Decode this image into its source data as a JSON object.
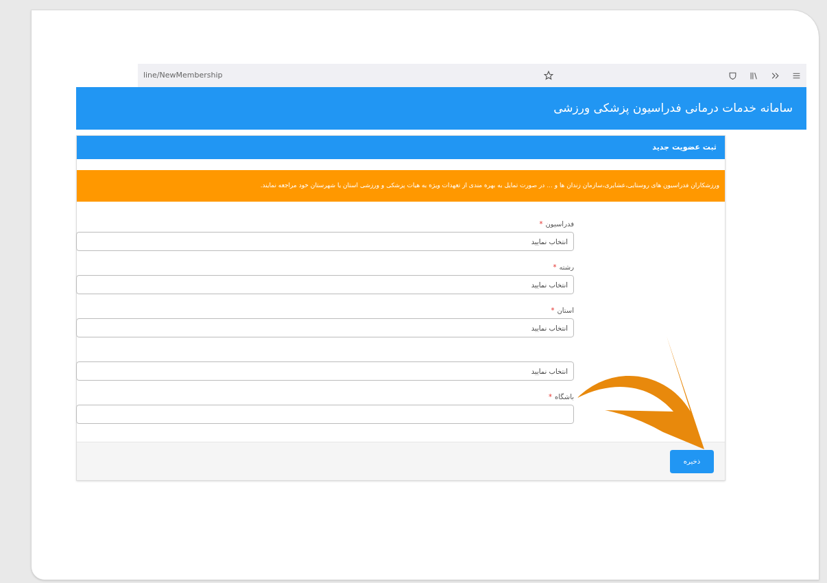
{
  "browser": {
    "url": "line/NewMembership"
  },
  "site_header": {
    "title": "سامانه خدمات درمانی فدراسیون پزشکی ورزشی"
  },
  "card": {
    "title": "ثبت عضویت جدید",
    "notice": "ورزشکاران فدراسیون های روستایی،عشایری،سازمان زندان ها و ... در صورت تمایل به بهره مندی از تعهدات ویژه به هیات پزشکی و ورزشی استان یا شهرستان خود مراجعه نمایند.",
    "fields": [
      {
        "kind": "select",
        "label": "فدراسیون",
        "required_mark": "*",
        "value": "انتخاب نمایید"
      },
      {
        "kind": "select",
        "label": "رشته",
        "required_mark": "*",
        "value": "انتخاب نمایید"
      },
      {
        "kind": "select",
        "label": "استان",
        "required_mark": "*",
        "value": "انتخاب نمایید"
      },
      {
        "kind": "select",
        "value": "انتخاب نمایید"
      },
      {
        "kind": "text",
        "label": "باشگاه",
        "required_mark": "*"
      }
    ],
    "save_button": "ذخیره"
  }
}
